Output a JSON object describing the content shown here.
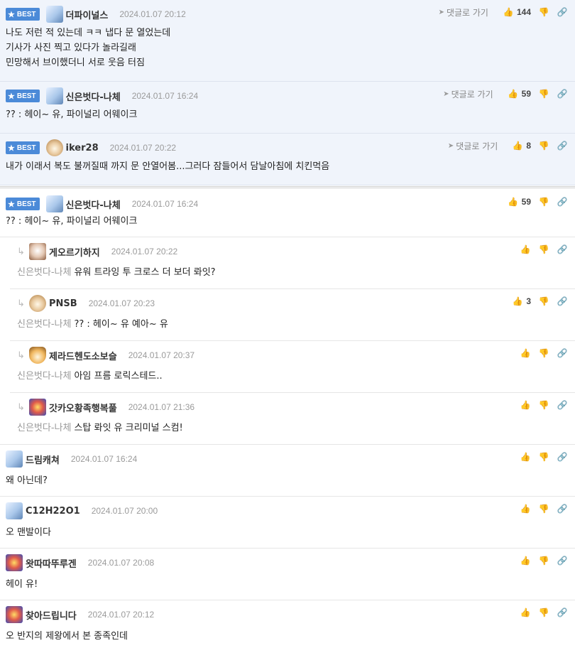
{
  "best_label": "BEST",
  "goto_label": "댓글로 가기",
  "reply_arrow": "↳",
  "best_comments": [
    {
      "nickname": "더파이널스",
      "avatar": "blue",
      "date": "2024.01.07 20:12",
      "likes": "144",
      "lines": [
        "나도 저런 적 있는데 ㅋㅋ 냅다 문 열었는데",
        "기사가 사진 찍고 있다가 놀라길래",
        "민망해서 브이했더니 서로 웃음 터짐"
      ]
    },
    {
      "nickname": "신은벗다-나체",
      "avatar": "blue",
      "date": "2024.01.07 16:24",
      "likes": "59",
      "lines": [
        "?? : 헤이~ 유, 파이널리 어웨이크"
      ]
    },
    {
      "nickname": "iker28",
      "avatar": "dog1",
      "date": "2024.01.07 20:22",
      "likes": "8",
      "lines": [
        "내가 이래서 복도 불꺼질때 까지 문 안열어봄...그러다 잠들어서 담날아침에 치킨먹음"
      ]
    }
  ],
  "thread": {
    "parent": {
      "nickname": "신은벗다-나체",
      "avatar": "blue",
      "date": "2024.01.07 16:24",
      "likes": "59",
      "text": "?? : 헤이~ 유, 파이널리 어웨이크"
    },
    "replies": [
      {
        "nickname": "게오르기하지",
        "avatar": "dog2",
        "date": "2024.01.07 20:22",
        "likes": "",
        "reply_to": "신은벗다-나체",
        "text": "유워 트라잉 투 크로스 더 보더 롸잇?"
      },
      {
        "nickname": "PNSB",
        "avatar": "dog1",
        "date": "2024.01.07 20:23",
        "likes": "3",
        "reply_to": "신은벗다-나체",
        "text": "?? : 헤이~ 유 예아~ 유"
      },
      {
        "nickname": "제라드헨도소보슬",
        "avatar": "fox",
        "date": "2024.01.07 20:37",
        "likes": "",
        "reply_to": "신은벗다-나체",
        "text": "아임 프름 로릭스테드.."
      },
      {
        "nickname": "갓카오황족행복풀",
        "avatar": "color",
        "date": "2024.01.07 21:36",
        "likes": "",
        "reply_to": "신은벗다-나체",
        "text": "스탑 롸잇 유 크리미널 스컴!"
      }
    ]
  },
  "comments": [
    {
      "nickname": "드림캐쳐",
      "avatar": "blue",
      "date": "2024.01.07 16:24",
      "likes": "",
      "text": "왜 아닌데?"
    },
    {
      "nickname": "C12H22O1",
      "avatar": "blue",
      "date": "2024.01.07 20:00",
      "likes": "",
      "text": "오 맨발이다"
    },
    {
      "nickname": "왓따따뚜루겐",
      "avatar": "color",
      "date": "2024.01.07 20:08",
      "likes": "",
      "text": "헤이 유!"
    },
    {
      "nickname": "찾아드립니다",
      "avatar": "color",
      "date": "2024.01.07 20:12",
      "likes": "",
      "text": "오 반지의 제왕에서 본 종족인데"
    }
  ],
  "icons": {
    "like": "thumbs-up-icon",
    "dislike": "thumbs-down-icon",
    "link": "link-icon",
    "goto": "send-arrow-icon",
    "star": "star-icon"
  },
  "colors": {
    "best_bg": "#f0f4fb",
    "badge": "#4b8ad8",
    "muted": "#9a9a9a"
  }
}
